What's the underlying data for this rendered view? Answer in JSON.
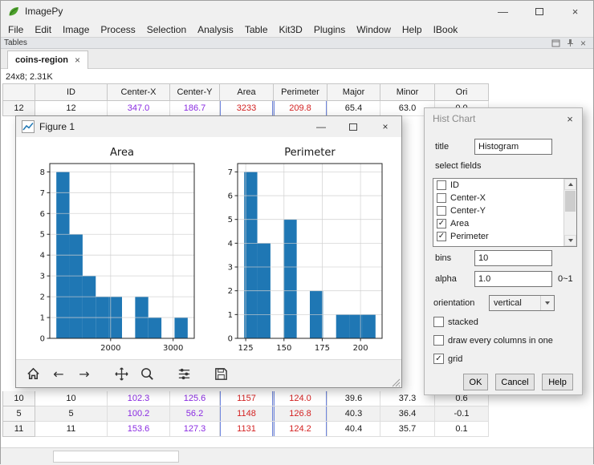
{
  "app": {
    "title": "ImagePy"
  },
  "icons": {
    "close": "×",
    "minimize": "—",
    "check": "✓",
    "back": "←",
    "forward": "→"
  },
  "menu": {
    "items": [
      "File",
      "Edit",
      "Image",
      "Process",
      "Selection",
      "Analysis",
      "Table",
      "Kit3D",
      "Plugins",
      "Window",
      "Help",
      "IBook"
    ]
  },
  "panel": {
    "title": "Tables"
  },
  "tabs": {
    "active": "coins-region"
  },
  "table": {
    "summary": "24x8; 2.31K",
    "columns": [
      "ID",
      "Center-X",
      "Center-Y",
      "Area",
      "Perimeter",
      "Major",
      "Minor",
      "Ori"
    ],
    "top_rows": [
      {
        "index": "12",
        "cells": [
          "12",
          "347.0",
          "186.7",
          "3233",
          "209.8",
          "65.4",
          "63.0",
          "0.0"
        ]
      }
    ],
    "bottom_rows": [
      {
        "index": "10",
        "cells": [
          "10",
          "102.3",
          "125.6",
          "1157",
          "124.0",
          "39.6",
          "37.3",
          "0.6"
        ]
      },
      {
        "index": "5",
        "cells": [
          "5",
          "100.2",
          "56.2",
          "1148",
          "126.8",
          "40.3",
          "36.4",
          "-0.1"
        ]
      },
      {
        "index": "11",
        "cells": [
          "11",
          "153.6",
          "127.3",
          "1131",
          "124.2",
          "40.4",
          "35.7",
          "0.1"
        ]
      }
    ],
    "colors": {
      "center_columns": "#8a2be2",
      "measure_columns": "#d42222"
    }
  },
  "figure": {
    "title": "Figure 1",
    "toolbar": [
      "home",
      "back",
      "forward",
      "pan",
      "zoom",
      "configure",
      "save"
    ]
  },
  "chart_data": [
    {
      "type": "bar",
      "title": "Area",
      "xlabel": "",
      "ylabel": "",
      "bin_start": 1131,
      "bin_width": 210.2,
      "values": [
        8,
        5,
        3,
        2,
        2,
        0,
        2,
        1,
        0,
        1
      ],
      "xticks": [
        2000,
        3000
      ],
      "yticks": [
        0,
        1,
        2,
        3,
        4,
        5,
        6,
        7,
        8
      ],
      "xlim": [
        1026,
        3338
      ],
      "ylim": [
        0,
        8.4
      ],
      "grid": true,
      "legend": "none",
      "bar_color": "#1f77b4"
    },
    {
      "type": "bar",
      "title": "Perimeter",
      "xlabel": "",
      "ylabel": "",
      "bin_start": 124.0,
      "bin_width": 8.58,
      "values": [
        7,
        4,
        0,
        5,
        0,
        2,
        0,
        1,
        1,
        1
      ],
      "xticks": [
        125,
        150,
        175,
        200
      ],
      "yticks": [
        0,
        1,
        2,
        3,
        4,
        5,
        6,
        7
      ],
      "xlim": [
        119.7,
        214.1
      ],
      "ylim": [
        0,
        7.35
      ],
      "grid": true,
      "legend": "none",
      "bar_color": "#1f77b4"
    }
  ],
  "dialog": {
    "title": "Hist Chart",
    "title_field": {
      "label": "title",
      "value": "Histogram"
    },
    "select_fields_label": "select fields",
    "field_options": [
      {
        "label": "ID",
        "checked": false
      },
      {
        "label": "Center-X",
        "checked": false
      },
      {
        "label": "Center-Y",
        "checked": false
      },
      {
        "label": "Area",
        "checked": true
      },
      {
        "label": "Perimeter",
        "checked": true
      }
    ],
    "bins": {
      "label": "bins",
      "value": "10"
    },
    "alpha": {
      "label": "alpha",
      "value": "1.0",
      "hint": "0~1"
    },
    "orientation": {
      "label": "orientation",
      "value": "vertical"
    },
    "checks": [
      {
        "label": "stacked",
        "checked": false
      },
      {
        "label": "draw every columns in one",
        "checked": false
      },
      {
        "label": "grid",
        "checked": true
      }
    ],
    "buttons": [
      "OK",
      "Cancel",
      "Help"
    ]
  }
}
